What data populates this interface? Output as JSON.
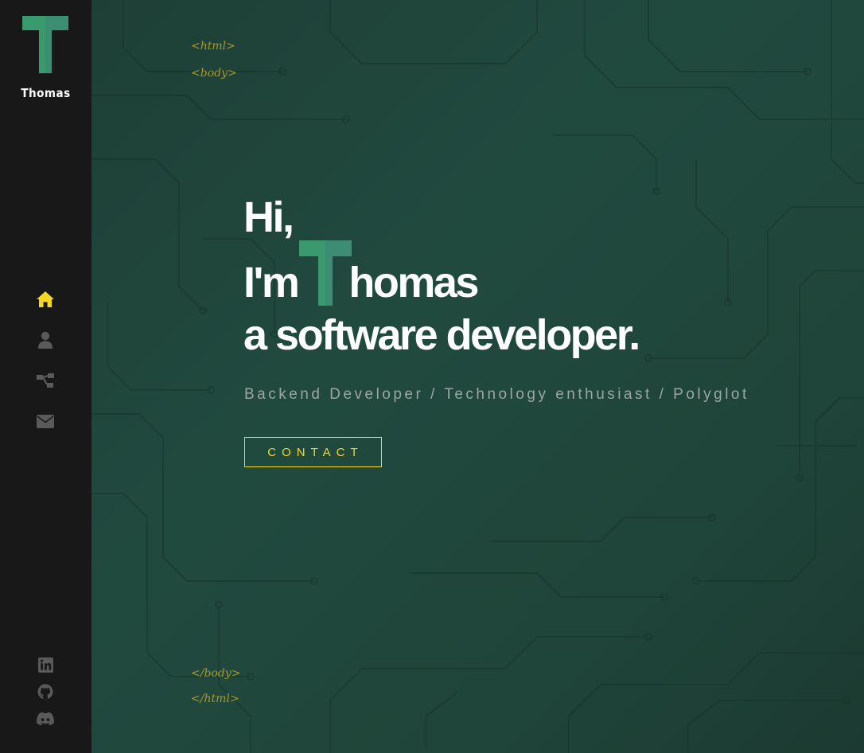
{
  "sidebar": {
    "logo_letter": "T",
    "logo_name": "Thomas",
    "nav": [
      {
        "icon": "home-icon",
        "label": "Home",
        "active": true
      },
      {
        "icon": "user-icon",
        "label": "About"
      },
      {
        "icon": "sitemap-icon",
        "label": "Projects"
      },
      {
        "icon": "envelope-icon",
        "label": "Contact"
      }
    ],
    "social": [
      {
        "icon": "linkedin-icon",
        "label": "LinkedIn"
      },
      {
        "icon": "github-icon",
        "label": "GitHub"
      },
      {
        "icon": "discord-icon",
        "label": "Discord"
      }
    ]
  },
  "tags": {
    "html_open": "<html>",
    "body_open": "<body>",
    "body_close": "</body>",
    "html_close": "</html>"
  },
  "hero": {
    "line1": "Hi,",
    "line2_prefix": "I'm",
    "line2_letter": "T",
    "line2_suffix": "homas",
    "line3": "a software developer.",
    "subtitle": "Backend Developer / Technology enthusiast / Polyglot",
    "cta": "CONTACT"
  },
  "colors": {
    "accent": "#f4d623",
    "brand_green": "#3a9a6e",
    "sidebar_bg": "#181818",
    "main_bg": "#214a3f",
    "tag_color": "#a89a2c",
    "icon_inactive": "#5a5a5a"
  }
}
